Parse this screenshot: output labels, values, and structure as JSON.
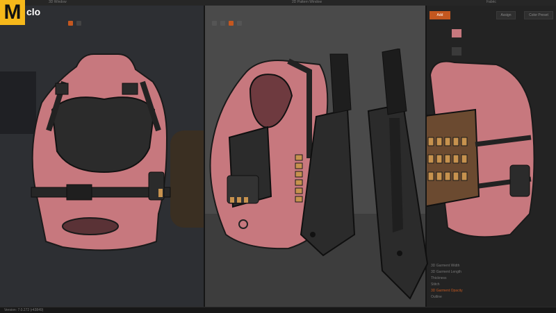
{
  "app": {
    "logo_letter": "M",
    "logo_suffix": "clo"
  },
  "views": {
    "left_title": "3D Window",
    "middle_title": "2D Pattern Window",
    "right_title": "Fabric"
  },
  "fabric_panel": {
    "tab1": "Add",
    "tab2": "Assign",
    "tab3": "Color Preset",
    "rows": [
      "3D Garment Width",
      "3D Garment Length",
      "Thickness",
      "Stitch",
      "3D Garment Opacity",
      "Outline"
    ]
  },
  "status_bar": {
    "text": "Version: 7.0.272 (r43849)"
  },
  "colors": {
    "accent": "#f6b81a",
    "fabric_pink": "#c7787e",
    "strap_black": "#2b2b2b",
    "ammo_tan": "#c7924e"
  }
}
